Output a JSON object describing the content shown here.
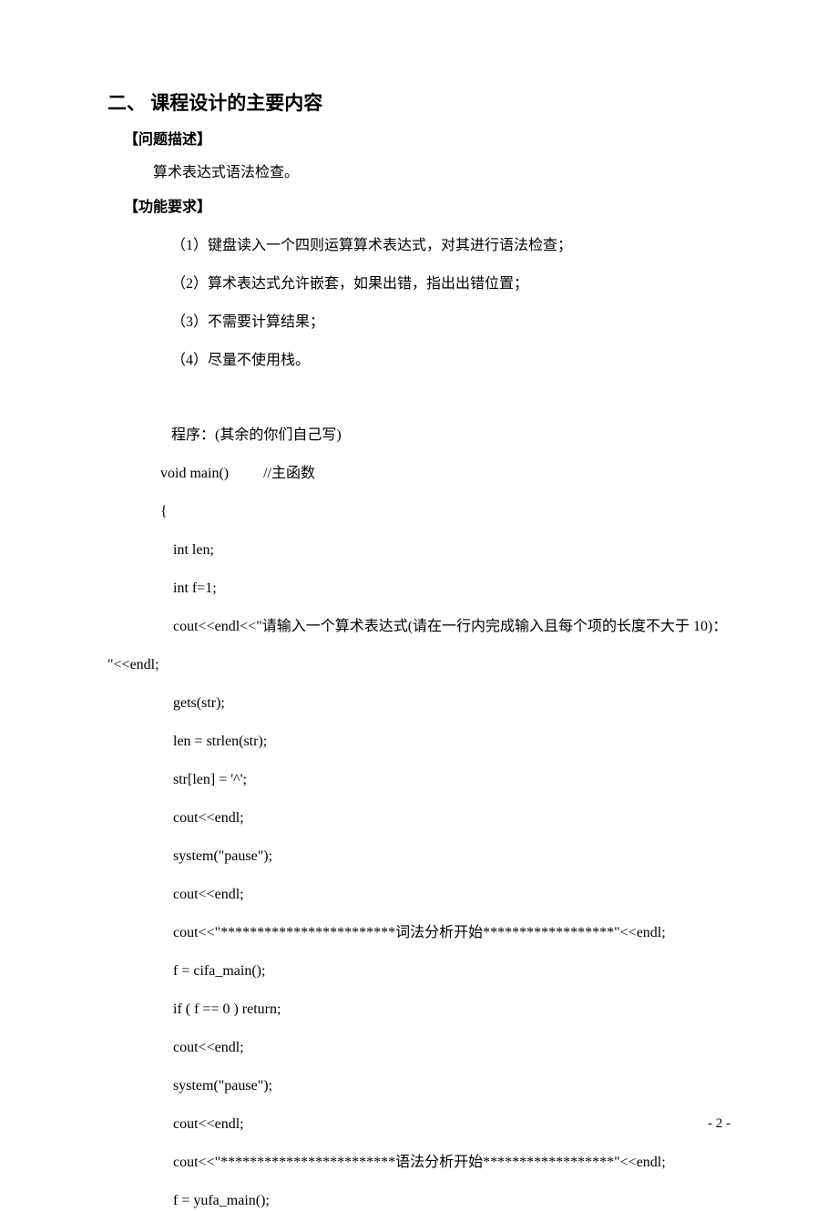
{
  "heading": "二、 课程设计的主要内容",
  "section_problem_title": "【问题描述】",
  "section_problem_text": "算术表达式语法检查。",
  "section_req_title": "【功能要求】",
  "requirements": [
    "（1）键盘读入一个四则运算算术表达式，对其进行语法检查；",
    "（2）算术表达式允许嵌套，如果出错，指出出错位置；",
    "（3）不需要计算结果；",
    "（4）尽量不使用栈。"
  ],
  "code_intro": "程序：(其余的你们自己写)",
  "code_sig_main": "void main()",
  "code_sig_comment": "//主函数",
  "code_open": "{",
  "code_lines": [
    "int len;",
    "int f=1;"
  ],
  "code_cout_prompt_a": "cout<<endl<<\"请输入一个算术表达式(请在一行内完成输入且每个项的长度不大于 10)：",
  "code_cout_prompt_b": "\"<<endl;",
  "code_lines2": [
    "gets(str);",
    "len = strlen(str);",
    "str[len] = '^';",
    "cout<<endl;",
    "system(\"pause\");",
    "cout<<endl;",
    "cout<<\"************************词法分析开始******************\"<<endl;",
    "f = cifa_main();",
    "if ( f == 0 ) return;",
    "cout<<endl;",
    "system(\"pause\");",
    "cout<<endl;",
    "cout<<\"************************语法分析开始******************\"<<endl;",
    "f = yufa_main();"
  ],
  "page_number": "- 2 -"
}
